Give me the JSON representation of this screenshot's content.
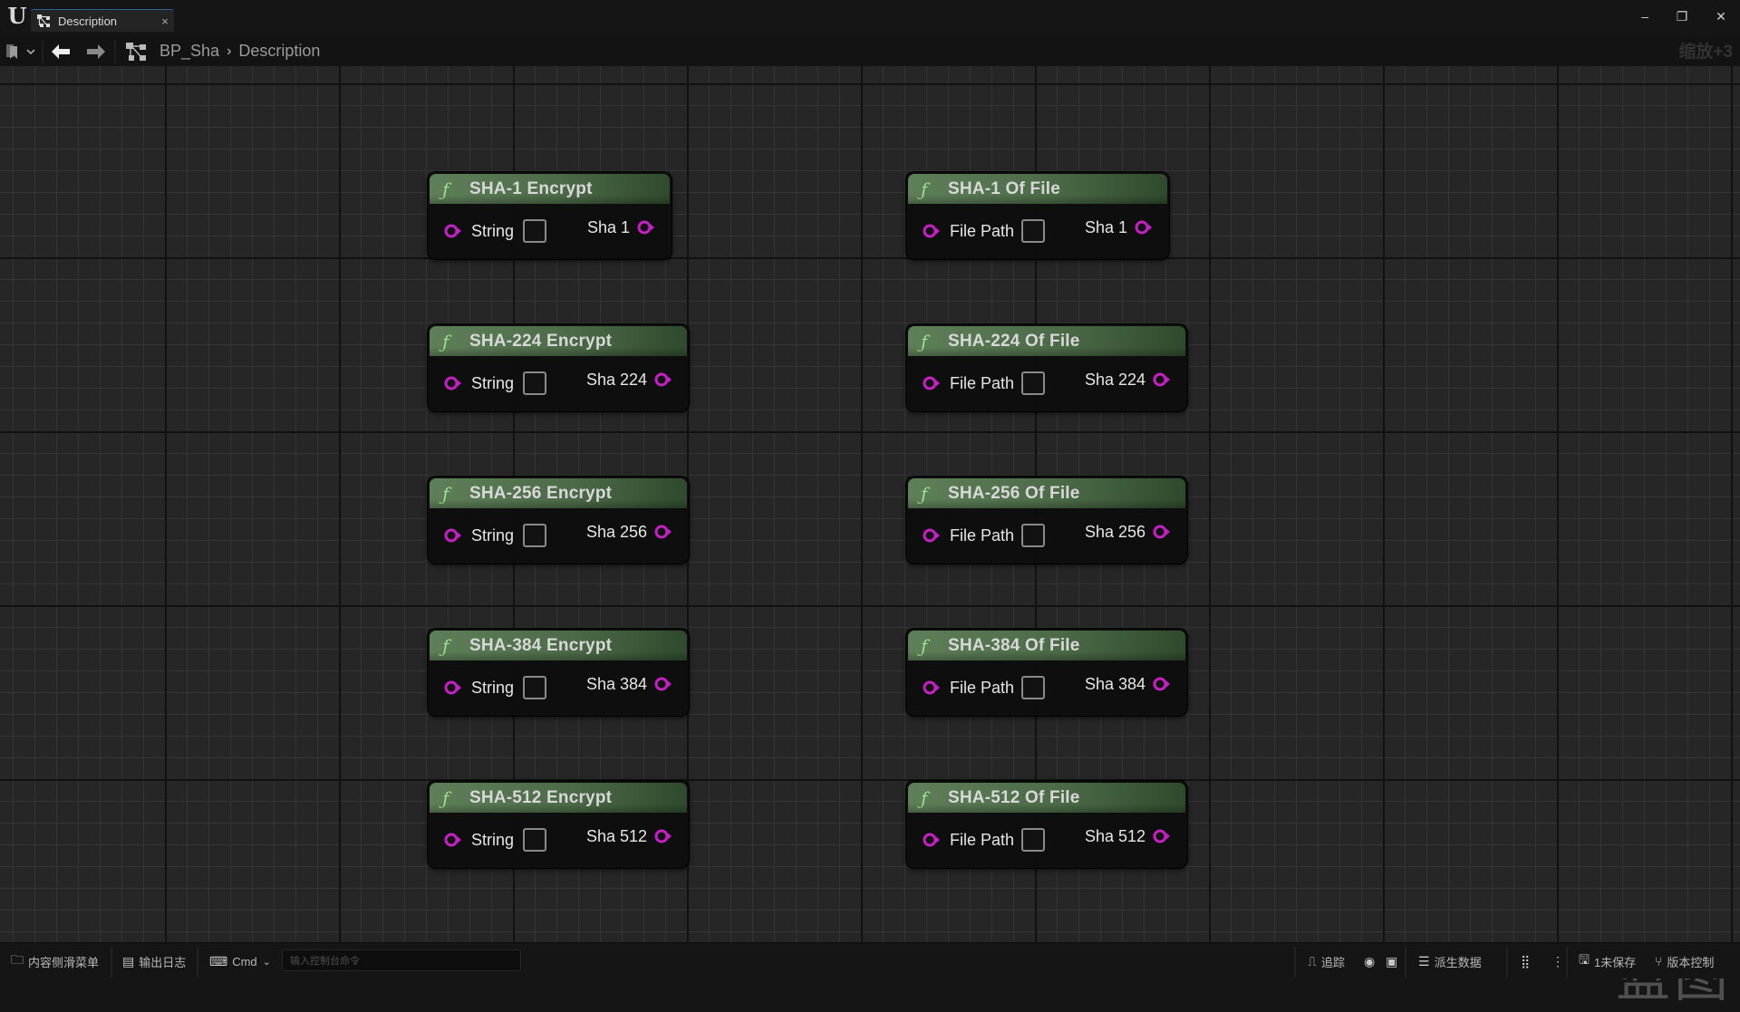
{
  "window": {
    "tab_label": "Description",
    "tab_close": "×",
    "minimize": "–",
    "maximize": "❐",
    "close": "✕"
  },
  "toolbar": {
    "breadcrumb": [
      "BP_Sha",
      "Description"
    ],
    "breadcrumb_separator": "›",
    "zoom_label": "缩放+3"
  },
  "graph": {
    "watermark": "蓝图",
    "pin_color": "#c420c4",
    "nodes": [
      {
        "title": "SHA-1 Encrypt",
        "input": "String",
        "output": "Sha 1"
      },
      {
        "title": "SHA-224 Encrypt",
        "input": "String",
        "output": "Sha 224"
      },
      {
        "title": "SHA-256 Encrypt",
        "input": "String",
        "output": "Sha 256"
      },
      {
        "title": "SHA-384 Encrypt",
        "input": "String",
        "output": "Sha 384"
      },
      {
        "title": "SHA-512 Encrypt",
        "input": "String",
        "output": "Sha 512"
      },
      {
        "title": "SHA-1 Of File",
        "input": "File Path",
        "output": "Sha 1"
      },
      {
        "title": "SHA-224 Of File",
        "input": "File Path",
        "output": "Sha 224"
      },
      {
        "title": "SHA-256 Of File",
        "input": "File Path",
        "output": "Sha 256"
      },
      {
        "title": "SHA-384 Of File",
        "input": "File Path",
        "output": "Sha 384"
      },
      {
        "title": "SHA-512 Of File",
        "input": "File Path",
        "output": "Sha 512"
      }
    ]
  },
  "statusbar": {
    "content_drawer": "内容侧滑菜单",
    "output_log": "输出日志",
    "cmd": "Cmd",
    "console_placeholder": "输入控制台命令",
    "trace": "追踪",
    "derived_data": "派生数据",
    "unsaved": "1未保存",
    "source_control": "版本控制"
  }
}
